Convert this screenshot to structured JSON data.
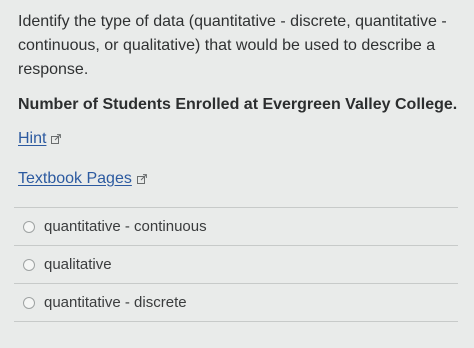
{
  "question": {
    "text": "Identify the type of data (quantitative - discrete, quantitative - continuous, or qualitative) that would be used to describe a response.",
    "prompt": "Number of Students Enrolled at Evergreen Valley College."
  },
  "links": {
    "hint": "Hint",
    "textbook": "Textbook Pages"
  },
  "options": [
    {
      "label": "quantitative - continuous"
    },
    {
      "label": "qualitative"
    },
    {
      "label": "quantitative - discrete"
    }
  ],
  "colors": {
    "link": "#2c5aa0",
    "background": "#e9ebea"
  }
}
